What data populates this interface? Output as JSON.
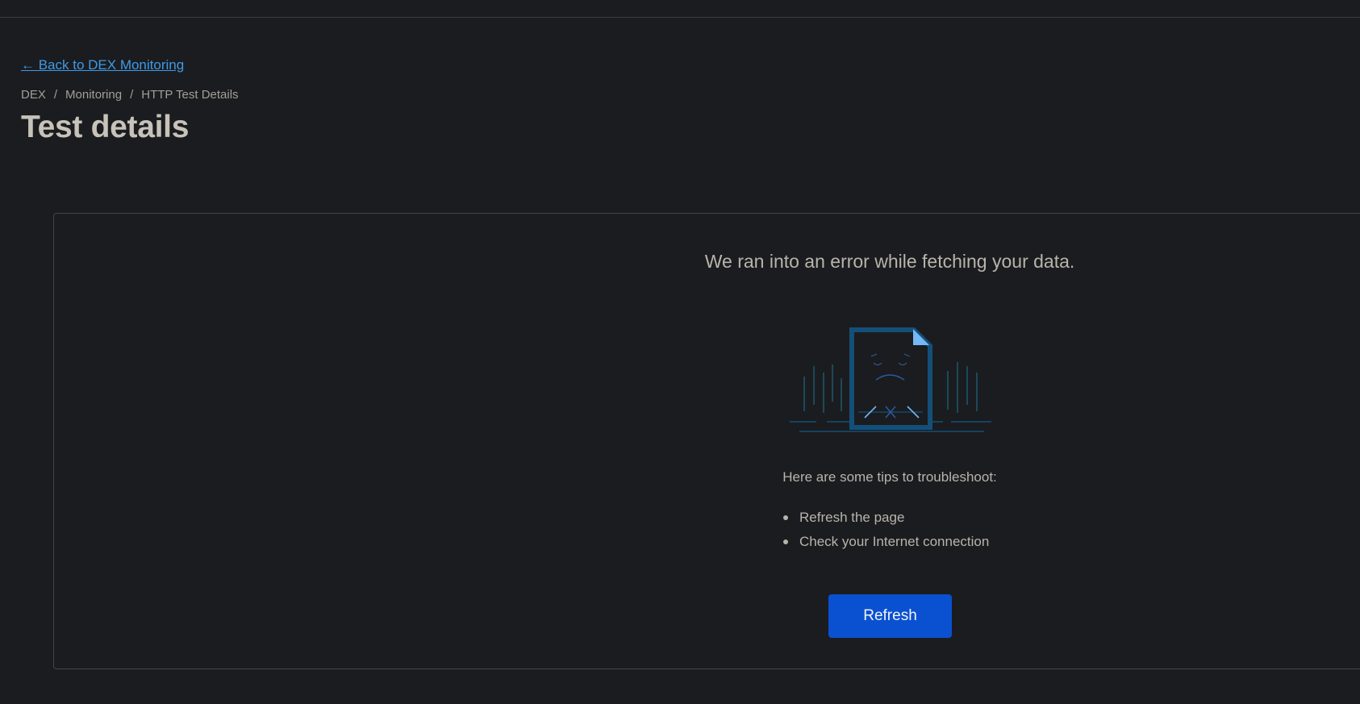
{
  "nav": {
    "back_link": "← Back to DEX Monitoring"
  },
  "breadcrumb": {
    "items": [
      "DEX",
      "Monitoring",
      "HTTP Test Details"
    ],
    "separator": "/"
  },
  "page": {
    "title": "Test details"
  },
  "error": {
    "message": "We ran into an error while fetching your data.",
    "illustration_icon": "sad-document-icon",
    "tips_heading": "Here are some tips to troubleshoot:",
    "tips": [
      "Refresh the page",
      "Check your Internet connection"
    ],
    "refresh_label": "Refresh"
  },
  "colors": {
    "background": "#1b1c1f",
    "link": "#3d9be9",
    "primary_button": "#0a51d1",
    "illustration_dark": "#134f78",
    "illustration_light": "#75b8f5"
  }
}
